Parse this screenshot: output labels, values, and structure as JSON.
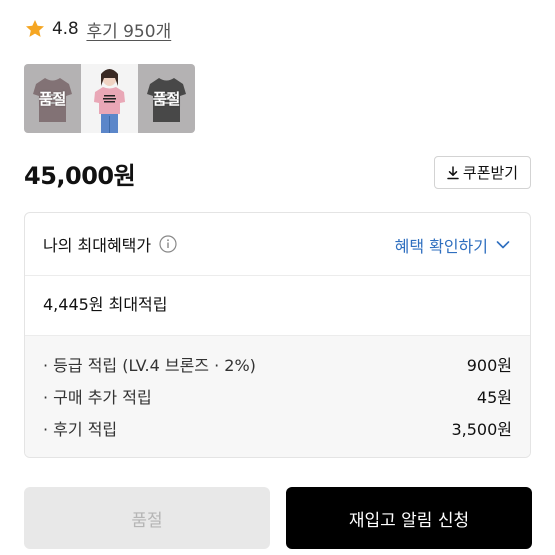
{
  "rating": {
    "score": "4.8",
    "review_link": "후기 950개",
    "star_color": "#f5a623"
  },
  "thumbnails": [
    {
      "name": "thumb-tshirt-pink-graphic",
      "soldout": true,
      "overlay_label": "품절",
      "shirt_color": "#8b6d73"
    },
    {
      "name": "thumb-model-pink-tshirt",
      "soldout": false,
      "overlay_label": "",
      "shirt_color": "#e9a7b6"
    },
    {
      "name": "thumb-tshirt-black-graphic",
      "soldout": true,
      "overlay_label": "품절",
      "shirt_color": "#222222"
    }
  ],
  "price": "45,000원",
  "coupon_button": {
    "label": "쿠폰받기",
    "icon": "download-icon"
  },
  "benefit": {
    "title": "나의 최대혜택가",
    "info_icon": "info-icon",
    "check_label": "혜택 확인하기",
    "check_color": "#2f6fbf",
    "max_points": "4,445원 최대적립",
    "details": [
      {
        "label": "· 등급 적립 (LV.4 브론즈 · 2%)",
        "amount": "900원"
      },
      {
        "label": "· 구매 추가 적립",
        "amount": "45원"
      },
      {
        "label": "· 후기 적립",
        "amount": "3,500원"
      }
    ]
  },
  "actions": {
    "soldout_label": "품절",
    "restock_label": "재입고 알림 신청"
  }
}
